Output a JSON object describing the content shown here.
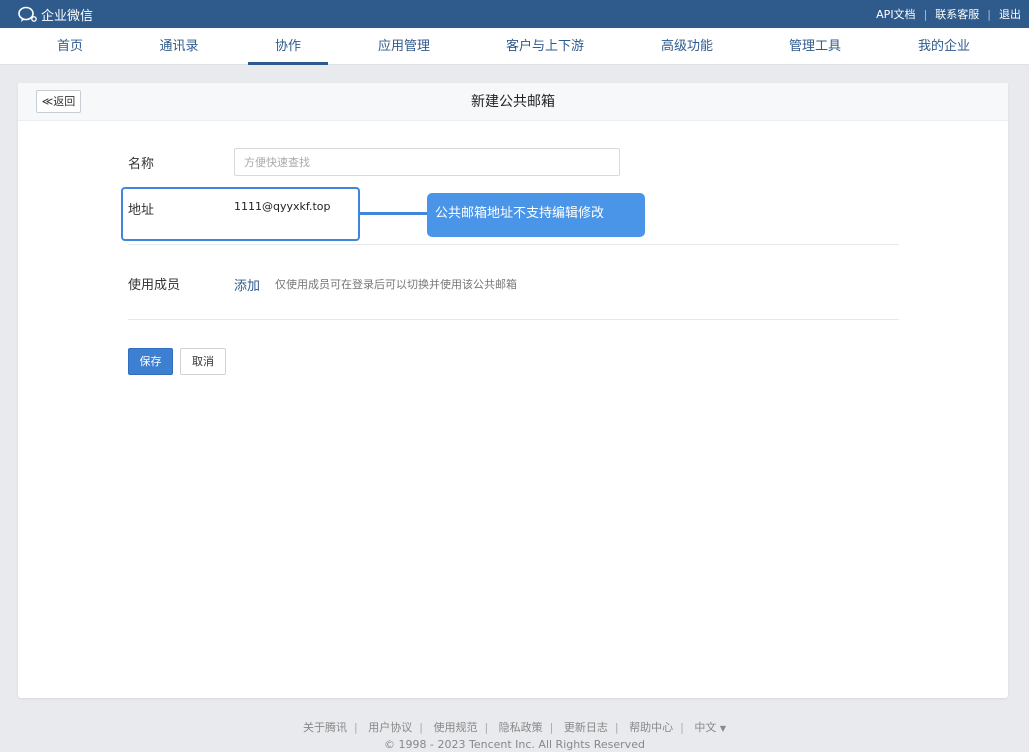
{
  "topbar": {
    "logo_text": "企业微信",
    "links": [
      "API文档",
      "联系客服",
      "退出"
    ]
  },
  "nav": {
    "items": [
      "首页",
      "通讯录",
      "协作",
      "应用管理",
      "客户与上下游",
      "高级功能",
      "管理工具",
      "我的企业"
    ],
    "active": "协作"
  },
  "page": {
    "back_label": "≪返回",
    "title": "新建公共邮箱"
  },
  "form": {
    "name_label": "名称",
    "name_placeholder": "方便快速查找",
    "address_label": "地址",
    "address_value": "1111@qyyxkf.top",
    "members_label": "使用成员",
    "add_label": "添加",
    "members_hint": "仅使用成员可在登录后可以切换并使用该公共邮箱",
    "save_label": "保存",
    "cancel_label": "取消"
  },
  "annotation": {
    "text": "公共邮箱地址不支持编辑修改",
    "color": "#4a95e8"
  },
  "footer": {
    "links": [
      "关于腾讯",
      "用户协议",
      "使用规范",
      "隐私政策",
      "更新日志",
      "帮助中心"
    ],
    "language": "中文",
    "copyright": "© 1998 - 2023 Tencent Inc. All Rights Reserved"
  },
  "colors": {
    "brand": "#2f5a8c",
    "primary_button": "#3d7fd0",
    "highlight": "#3f87dd"
  }
}
